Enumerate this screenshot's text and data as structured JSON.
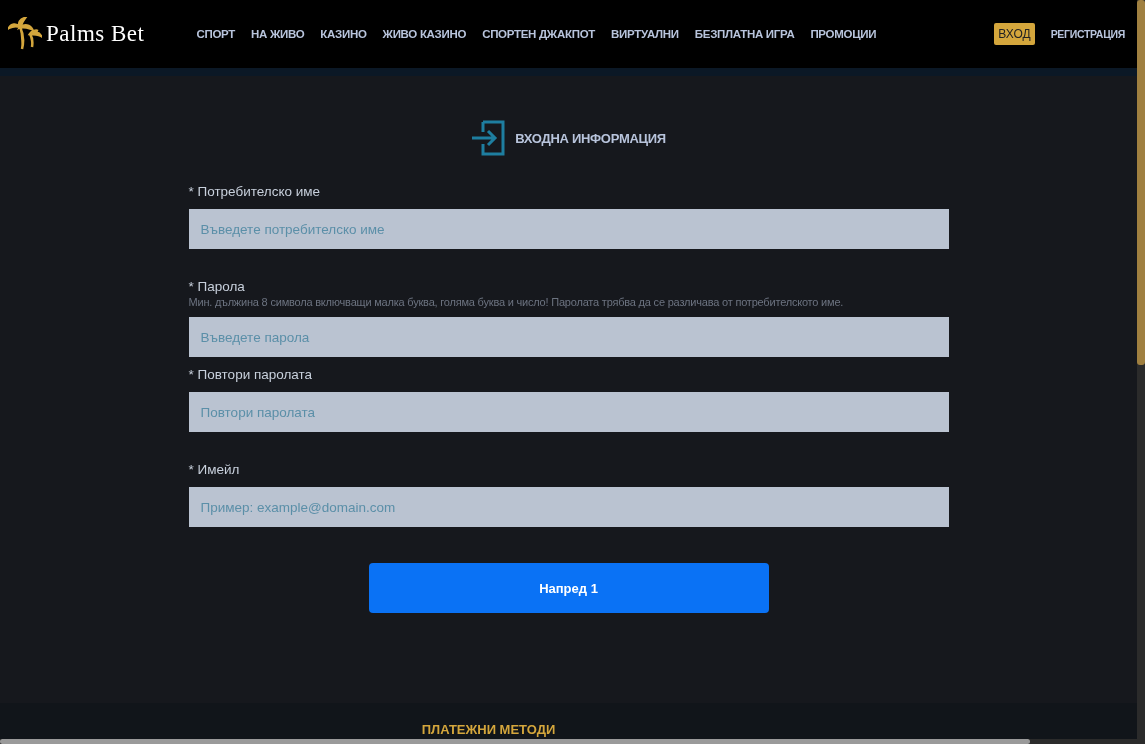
{
  "header": {
    "logo": "Palms Bet",
    "nav": [
      {
        "label": "СПОРТ"
      },
      {
        "label": "НА ЖИВО"
      },
      {
        "label": "КАЗИНО"
      },
      {
        "label": "ЖИВО КАЗИНО"
      },
      {
        "label": "СПОРТЕН ДЖАКПОТ"
      },
      {
        "label": "ВИРТУАЛНИ"
      },
      {
        "label": "БЕЗПЛАТНА ИГРА"
      },
      {
        "label": "ПРОМОЦИИ"
      }
    ],
    "login": "ВХОД",
    "register": "РЕГИСТРАЦИЯ"
  },
  "form": {
    "title": "ВХОДНА ИНФОРМАЦИЯ",
    "fields": [
      {
        "label": "* Потребителско име",
        "placeholder": "Въведете потребителско име"
      },
      {
        "label": "* Парола",
        "hint": "Мин. дължина 8 символа включващи малка буква, голяма буква и число! Паролата трябва да се различава от потребителското име.",
        "placeholder": "Въведете парола"
      },
      {
        "label": "* Повтори паролата",
        "placeholder": "Повтори паролата"
      },
      {
        "label": "* Имейл",
        "placeholder": "Пример: example@domain.com"
      }
    ],
    "submit": "Напред 1"
  },
  "footer": {
    "title": "ПЛАТЕЖНИ МЕТОДИ"
  }
}
